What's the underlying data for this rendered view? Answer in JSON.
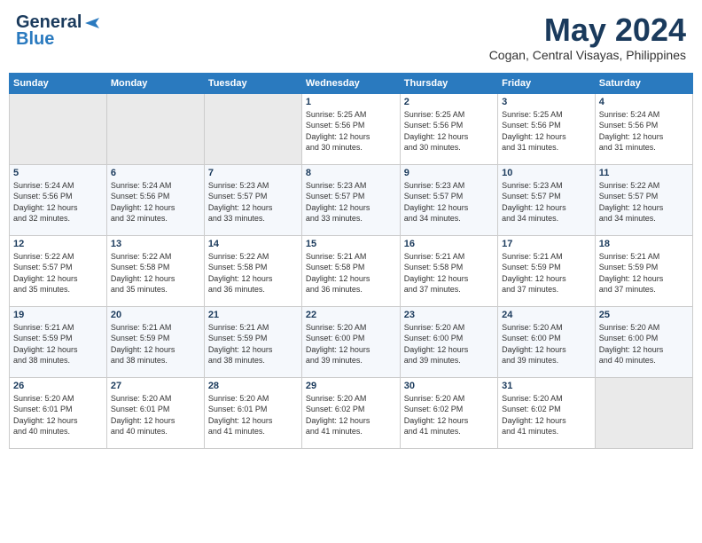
{
  "logo": {
    "general": "General",
    "blue": "Blue"
  },
  "header": {
    "month": "May 2024",
    "location": "Cogan, Central Visayas, Philippines"
  },
  "weekdays": [
    "Sunday",
    "Monday",
    "Tuesday",
    "Wednesday",
    "Thursday",
    "Friday",
    "Saturday"
  ],
  "weeks": [
    [
      {
        "day": "",
        "info": ""
      },
      {
        "day": "",
        "info": ""
      },
      {
        "day": "",
        "info": ""
      },
      {
        "day": "1",
        "info": "Sunrise: 5:25 AM\nSunset: 5:56 PM\nDaylight: 12 hours\nand 30 minutes."
      },
      {
        "day": "2",
        "info": "Sunrise: 5:25 AM\nSunset: 5:56 PM\nDaylight: 12 hours\nand 30 minutes."
      },
      {
        "day": "3",
        "info": "Sunrise: 5:25 AM\nSunset: 5:56 PM\nDaylight: 12 hours\nand 31 minutes."
      },
      {
        "day": "4",
        "info": "Sunrise: 5:24 AM\nSunset: 5:56 PM\nDaylight: 12 hours\nand 31 minutes."
      }
    ],
    [
      {
        "day": "5",
        "info": "Sunrise: 5:24 AM\nSunset: 5:56 PM\nDaylight: 12 hours\nand 32 minutes."
      },
      {
        "day": "6",
        "info": "Sunrise: 5:24 AM\nSunset: 5:56 PM\nDaylight: 12 hours\nand 32 minutes."
      },
      {
        "day": "7",
        "info": "Sunrise: 5:23 AM\nSunset: 5:57 PM\nDaylight: 12 hours\nand 33 minutes."
      },
      {
        "day": "8",
        "info": "Sunrise: 5:23 AM\nSunset: 5:57 PM\nDaylight: 12 hours\nand 33 minutes."
      },
      {
        "day": "9",
        "info": "Sunrise: 5:23 AM\nSunset: 5:57 PM\nDaylight: 12 hours\nand 34 minutes."
      },
      {
        "day": "10",
        "info": "Sunrise: 5:23 AM\nSunset: 5:57 PM\nDaylight: 12 hours\nand 34 minutes."
      },
      {
        "day": "11",
        "info": "Sunrise: 5:22 AM\nSunset: 5:57 PM\nDaylight: 12 hours\nand 34 minutes."
      }
    ],
    [
      {
        "day": "12",
        "info": "Sunrise: 5:22 AM\nSunset: 5:57 PM\nDaylight: 12 hours\nand 35 minutes."
      },
      {
        "day": "13",
        "info": "Sunrise: 5:22 AM\nSunset: 5:58 PM\nDaylight: 12 hours\nand 35 minutes."
      },
      {
        "day": "14",
        "info": "Sunrise: 5:22 AM\nSunset: 5:58 PM\nDaylight: 12 hours\nand 36 minutes."
      },
      {
        "day": "15",
        "info": "Sunrise: 5:21 AM\nSunset: 5:58 PM\nDaylight: 12 hours\nand 36 minutes."
      },
      {
        "day": "16",
        "info": "Sunrise: 5:21 AM\nSunset: 5:58 PM\nDaylight: 12 hours\nand 37 minutes."
      },
      {
        "day": "17",
        "info": "Sunrise: 5:21 AM\nSunset: 5:59 PM\nDaylight: 12 hours\nand 37 minutes."
      },
      {
        "day": "18",
        "info": "Sunrise: 5:21 AM\nSunset: 5:59 PM\nDaylight: 12 hours\nand 37 minutes."
      }
    ],
    [
      {
        "day": "19",
        "info": "Sunrise: 5:21 AM\nSunset: 5:59 PM\nDaylight: 12 hours\nand 38 minutes."
      },
      {
        "day": "20",
        "info": "Sunrise: 5:21 AM\nSunset: 5:59 PM\nDaylight: 12 hours\nand 38 minutes."
      },
      {
        "day": "21",
        "info": "Sunrise: 5:21 AM\nSunset: 5:59 PM\nDaylight: 12 hours\nand 38 minutes."
      },
      {
        "day": "22",
        "info": "Sunrise: 5:20 AM\nSunset: 6:00 PM\nDaylight: 12 hours\nand 39 minutes."
      },
      {
        "day": "23",
        "info": "Sunrise: 5:20 AM\nSunset: 6:00 PM\nDaylight: 12 hours\nand 39 minutes."
      },
      {
        "day": "24",
        "info": "Sunrise: 5:20 AM\nSunset: 6:00 PM\nDaylight: 12 hours\nand 39 minutes."
      },
      {
        "day": "25",
        "info": "Sunrise: 5:20 AM\nSunset: 6:00 PM\nDaylight: 12 hours\nand 40 minutes."
      }
    ],
    [
      {
        "day": "26",
        "info": "Sunrise: 5:20 AM\nSunset: 6:01 PM\nDaylight: 12 hours\nand 40 minutes."
      },
      {
        "day": "27",
        "info": "Sunrise: 5:20 AM\nSunset: 6:01 PM\nDaylight: 12 hours\nand 40 minutes."
      },
      {
        "day": "28",
        "info": "Sunrise: 5:20 AM\nSunset: 6:01 PM\nDaylight: 12 hours\nand 41 minutes."
      },
      {
        "day": "29",
        "info": "Sunrise: 5:20 AM\nSunset: 6:02 PM\nDaylight: 12 hours\nand 41 minutes."
      },
      {
        "day": "30",
        "info": "Sunrise: 5:20 AM\nSunset: 6:02 PM\nDaylight: 12 hours\nand 41 minutes."
      },
      {
        "day": "31",
        "info": "Sunrise: 5:20 AM\nSunset: 6:02 PM\nDaylight: 12 hours\nand 41 minutes."
      },
      {
        "day": "",
        "info": ""
      }
    ]
  ]
}
